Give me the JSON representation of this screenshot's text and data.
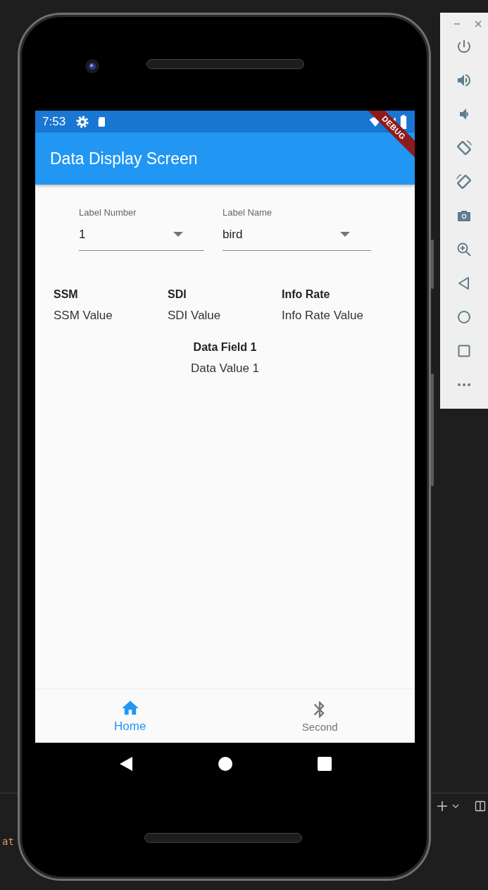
{
  "status_bar": {
    "time": "7:53"
  },
  "debug_banner": "DEBUG",
  "app_bar": {
    "title": "Data Display Screen"
  },
  "dropdowns": [
    {
      "label": "Label Number",
      "value": "1"
    },
    {
      "label": "Label Name",
      "value": "bird"
    }
  ],
  "stats": [
    {
      "heading": "SSM",
      "value": "SSM Value"
    },
    {
      "heading": "SDI",
      "value": "SDI Value"
    },
    {
      "heading": "Info Rate",
      "value": "Info Rate Value"
    }
  ],
  "data_field": {
    "heading": "Data Field 1",
    "value": "Data Value 1"
  },
  "bottom_nav": [
    {
      "label": "Home",
      "selected": true
    },
    {
      "label": "Second",
      "selected": false
    }
  ],
  "background_editor": {
    "text_fragment": "at"
  }
}
